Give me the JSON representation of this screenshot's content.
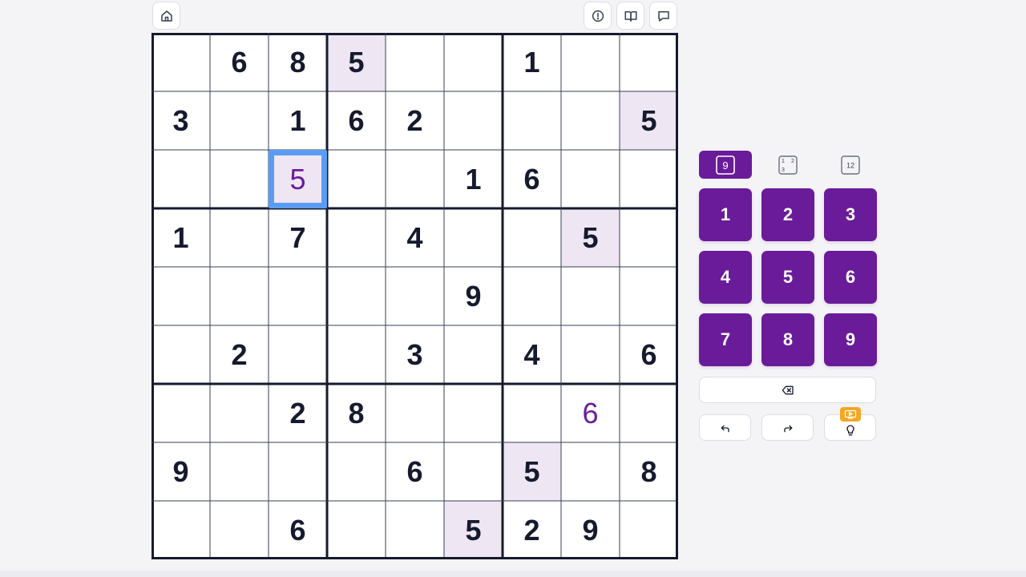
{
  "header": {
    "home_icon": "home-icon",
    "right_icons": [
      "info-icon",
      "book-icon",
      "chat-icon"
    ]
  },
  "board": {
    "grid": [
      [
        0,
        6,
        8,
        5,
        0,
        0,
        1,
        0,
        0
      ],
      [
        3,
        0,
        1,
        6,
        2,
        0,
        0,
        0,
        5
      ],
      [
        0,
        0,
        5,
        0,
        0,
        1,
        6,
        0,
        0
      ],
      [
        1,
        0,
        7,
        0,
        4,
        0,
        0,
        5,
        0
      ],
      [
        0,
        0,
        0,
        0,
        0,
        9,
        0,
        0,
        0
      ],
      [
        0,
        2,
        0,
        0,
        3,
        0,
        4,
        0,
        6
      ],
      [
        0,
        0,
        2,
        8,
        0,
        0,
        0,
        6,
        0
      ],
      [
        9,
        0,
        0,
        0,
        6,
        0,
        5,
        0,
        8
      ],
      [
        0,
        0,
        6,
        0,
        0,
        5,
        2,
        9,
        0
      ]
    ],
    "user_entries": [
      [
        2,
        2
      ],
      [
        6,
        7
      ]
    ],
    "selected_cell": [
      2,
      2
    ],
    "highlighted_digit": 5
  },
  "controls": {
    "modes": [
      {
        "name": "normal-mode",
        "label": "9",
        "active": true
      },
      {
        "name": "corner-notes-mode",
        "label": "1 2 3",
        "active": false
      },
      {
        "name": "center-notes-mode",
        "label": "12",
        "active": false
      }
    ],
    "digits": [
      "1",
      "2",
      "3",
      "4",
      "5",
      "6",
      "7",
      "8",
      "9"
    ],
    "erase_icon": "backspace-icon",
    "undo_icon": "undo-icon",
    "redo_icon": "redo-icon",
    "hint_icon": "lightbulb-icon",
    "hint_badge_icon": "video-icon"
  },
  "colors": {
    "accent": "#6a1b9a",
    "highlight": "#eee6f3",
    "selection": "#5b9cf2",
    "given_digit": "#161a2e",
    "badge": "#f5a623"
  }
}
